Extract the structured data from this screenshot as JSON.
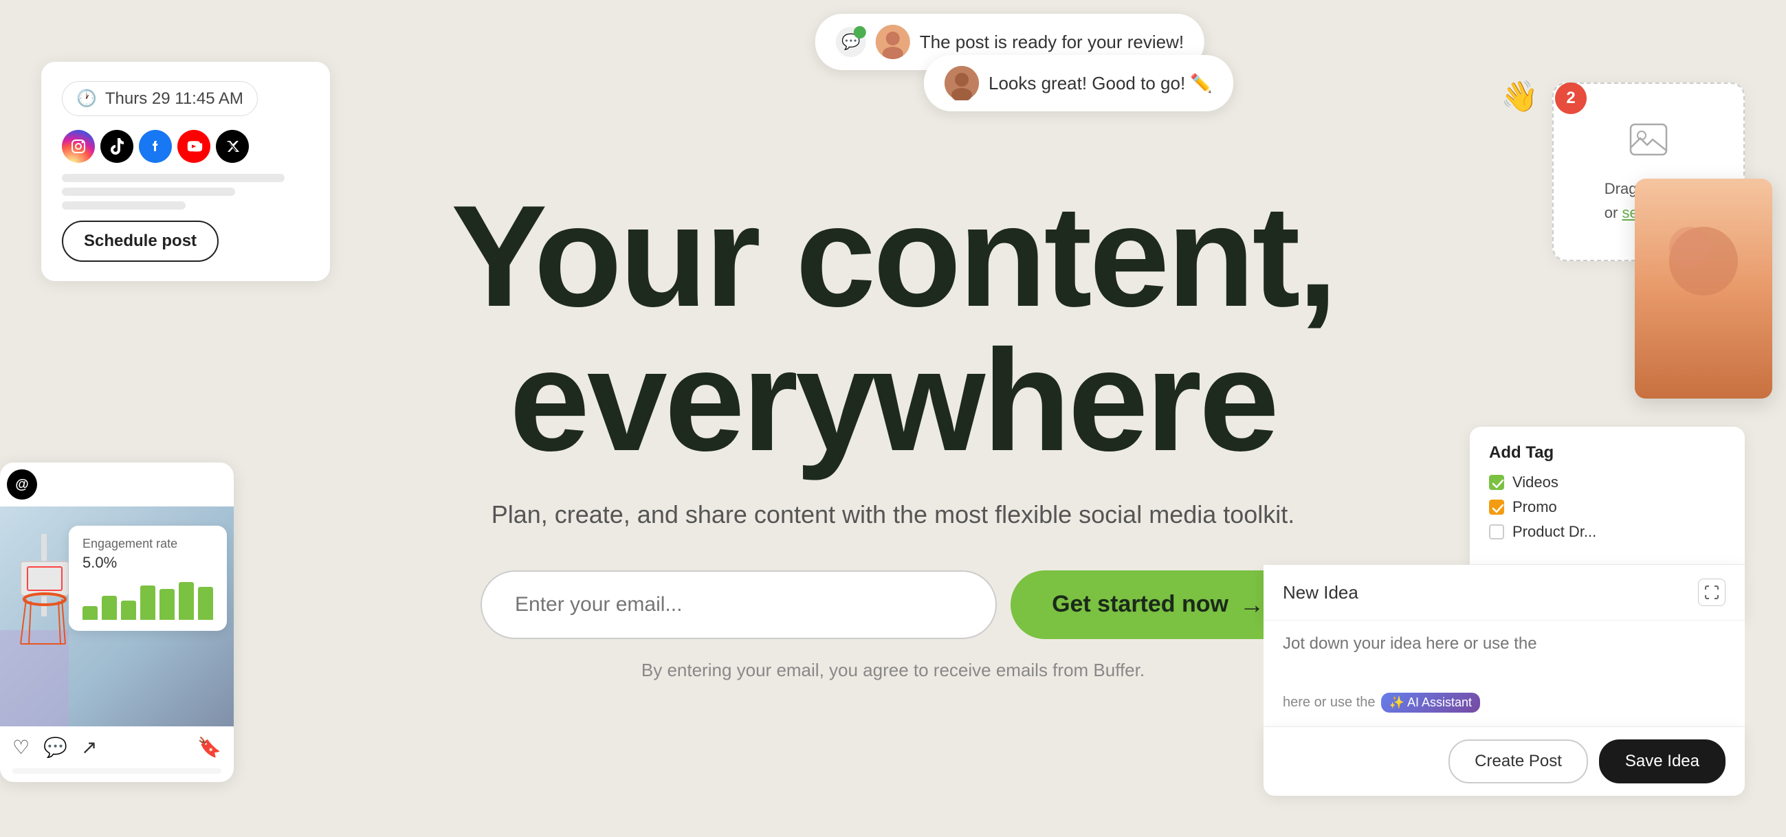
{
  "page": {
    "background": "#EDEAE3"
  },
  "hero": {
    "title_line1": "Your content,",
    "title_line2": "everywhere",
    "subtitle": "Plan, create, and share content with the most flexible social media toolkit.",
    "email_placeholder": "Enter your email...",
    "cta_label": "Get started now",
    "disclaimer": "By entering your email, you agree to receive emails from Buffer."
  },
  "notifications": {
    "pill1_text": "The post is ready for your review!",
    "pill2_text": "Looks great! Good to go! ✏️"
  },
  "schedule_widget": {
    "date_time": "Thurs 29  11:45 AM",
    "button_label": "Schedule post"
  },
  "engagement": {
    "title": "Engagement rate",
    "rate": "5.0%",
    "bars": [
      20,
      35,
      28,
      50,
      60,
      75,
      65
    ]
  },
  "drag_drop": {
    "text": "Drag and drop",
    "subtext": "or select files",
    "badge_count": "2"
  },
  "add_tag": {
    "title": "Add Tag",
    "tags": [
      {
        "label": "Videos",
        "checked": true,
        "color": "green"
      },
      {
        "label": "Promo",
        "checked": true,
        "color": "orange"
      },
      {
        "label": "Product Dr...",
        "checked": false,
        "color": "none"
      }
    ]
  },
  "new_idea": {
    "label": "New Idea",
    "textarea_placeholder": "Jot down your idea here or use the",
    "ai_label": "✨ AI Assistant",
    "create_post_label": "Create Post",
    "save_idea_label": "Save Idea"
  }
}
